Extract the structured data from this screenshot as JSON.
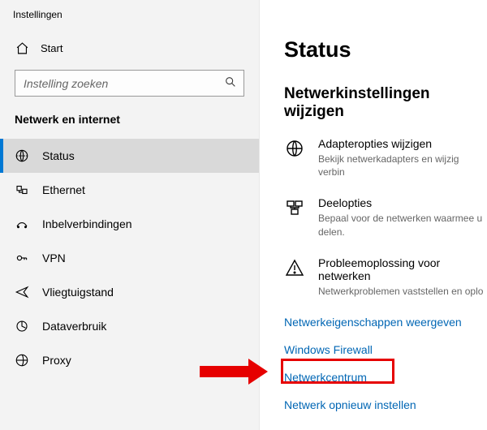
{
  "window_title": "Instellingen",
  "home_label": "Start",
  "search_placeholder": "Instelling zoeken",
  "section_title": "Netwerk en internet",
  "nav": [
    {
      "icon": "status",
      "label": "Status",
      "selected": true
    },
    {
      "icon": "ethernet",
      "label": "Ethernet"
    },
    {
      "icon": "dialup",
      "label": "Inbelverbindingen"
    },
    {
      "icon": "vpn",
      "label": "VPN"
    },
    {
      "icon": "airplane",
      "label": "Vliegtuigstand"
    },
    {
      "icon": "datausage",
      "label": "Dataverbruik"
    },
    {
      "icon": "proxy",
      "label": "Proxy"
    }
  ],
  "main_heading": "Status",
  "sub_heading": "Netwerkinstellingen wijzigen",
  "options": [
    {
      "icon": "adapter",
      "title": "Adapteropties wijzigen",
      "desc": "Bekijk netwerkadapters en wijzig verbin"
    },
    {
      "icon": "sharing",
      "title": "Deelopties",
      "desc": "Bepaal voor de netwerken waarmee u  delen."
    },
    {
      "icon": "trouble",
      "title": "Probleemoplossing voor netwerken",
      "desc": "Netwerkproblemen vaststellen en oplo"
    }
  ],
  "links": [
    "Netwerkeigenschappen weergeven",
    "Windows Firewall",
    "Netwerkcentrum",
    "Netwerk opnieuw instellen"
  ],
  "highlight_link_index": 2
}
